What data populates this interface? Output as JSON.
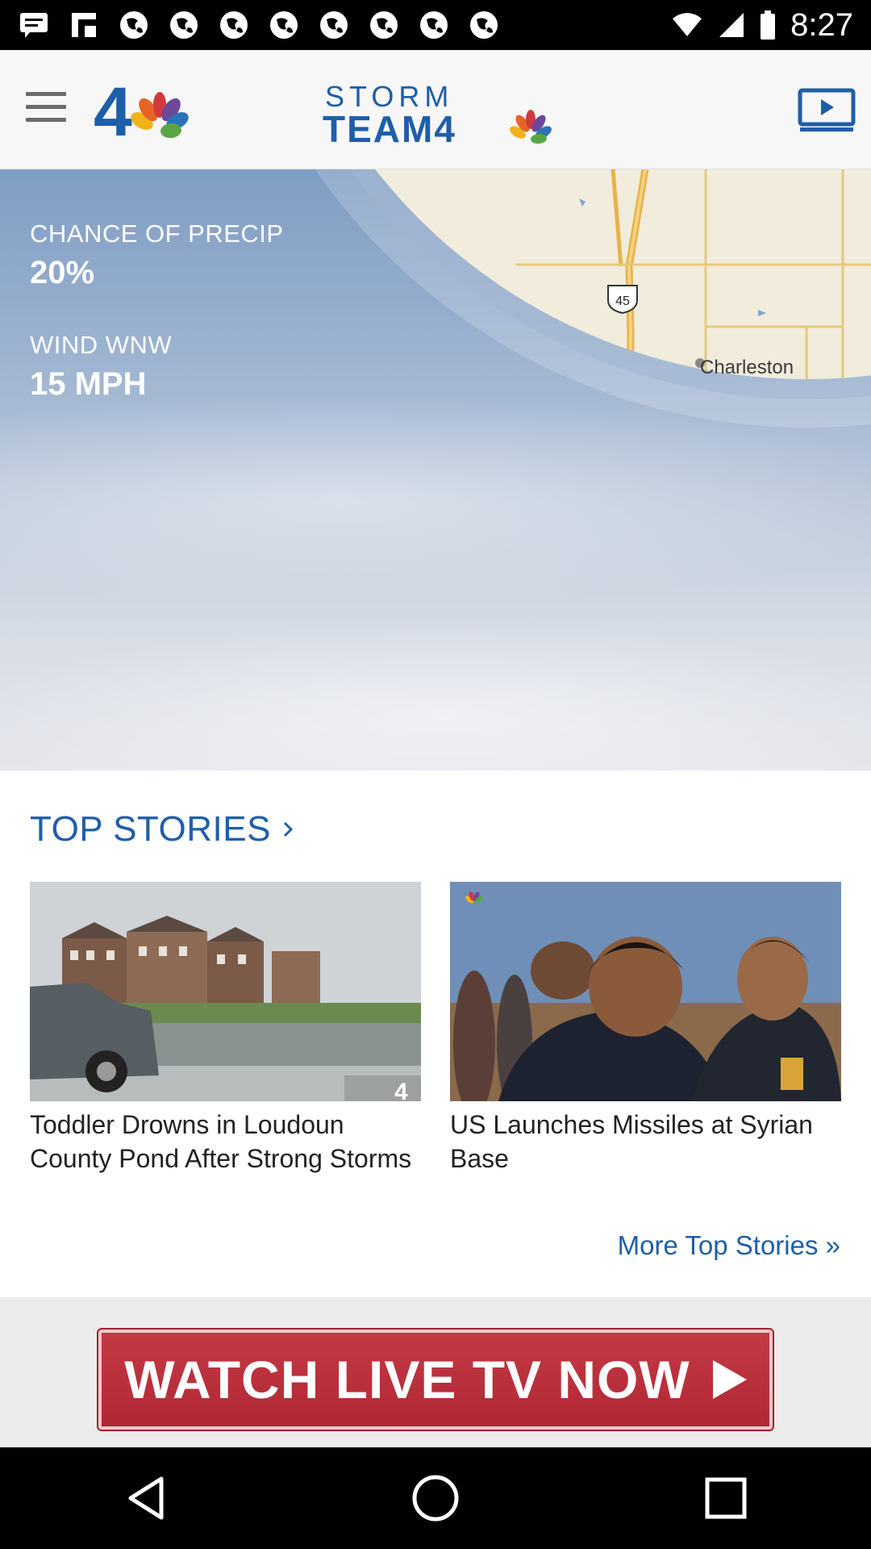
{
  "status_bar": {
    "time": "8:27",
    "icons": [
      "message-icon",
      "flipboard-icon",
      "globe-icon",
      "globe-icon",
      "globe-icon",
      "globe-icon",
      "globe-icon",
      "globe-icon",
      "globe-icon",
      "globe-icon"
    ]
  },
  "header": {
    "left_logo": "4",
    "center_logo_line1": "STORM",
    "center_logo_line2": "TEAM4"
  },
  "weather": {
    "precip_label": "CHANCE OF PRECIP",
    "precip_value": "20%",
    "wind_label": "WIND WNW",
    "wind_value": "15 MPH",
    "map_city": "Charleston",
    "map_route": "45"
  },
  "top_stories": {
    "title": "TOP STORIES",
    "stories": [
      {
        "title": "Toddler Drowns in Loudoun County Pond After Strong Storms"
      },
      {
        "title": "US Launches Missiles at Syrian Base"
      }
    ],
    "more_link": "More Top Stories »"
  },
  "live_tv": {
    "label": "WATCH LIVE TV NOW"
  },
  "colors": {
    "accent": "#1f5ea8",
    "live_red": "#b12734"
  }
}
